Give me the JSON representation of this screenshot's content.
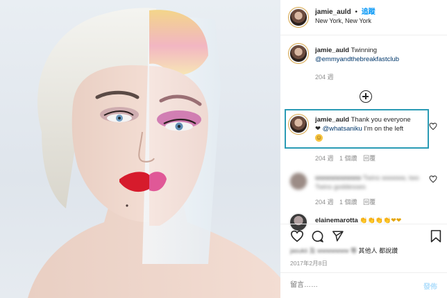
{
  "post_header": {
    "username": "jamie_auld",
    "separator": "•",
    "follow_label": "追蹤",
    "location": "New York, New York"
  },
  "caption": {
    "username": "jamie_auld",
    "text": "Twinning",
    "mention": "@emmyandthebreakfastclub",
    "time": "204 週"
  },
  "load_more_icon": "plus-circle-icon",
  "highlighted_comment": {
    "username": "jamie_auld",
    "text": "Thank you everyone",
    "heart_glyph": "❤",
    "mention": "@whatsaniku",
    "text_after": "I'm on the left",
    "emoji": "☺",
    "time": "204 週",
    "likes": "1 個讚",
    "reply": "回覆",
    "highlight_color": "#2a9bb5"
  },
  "blurred_comment_1": {
    "username": "wwwwwwwww",
    "text": "Twins wwwww, two",
    "text2": "Twins goddesses",
    "time": "204 週",
    "likes": "1 個讚",
    "reply": "回覆"
  },
  "partial_comment": {
    "username": "elainemarotta",
    "emoji": "👏👏👏👏❤❤"
  },
  "actions": {
    "like_icon": "heart-icon",
    "comment_icon": "comment-icon",
    "share_icon": "share-icon",
    "save_icon": "bookmark-icon"
  },
  "likes_summary": {
    "blurred_names": "jasukii 及 wwwwwww 等",
    "others_label": "其他人",
    "suffix": "都說讚"
  },
  "post_date": "2017年2月8日",
  "comment_input": {
    "placeholder": "留言……",
    "post_label": "發佈"
  }
}
